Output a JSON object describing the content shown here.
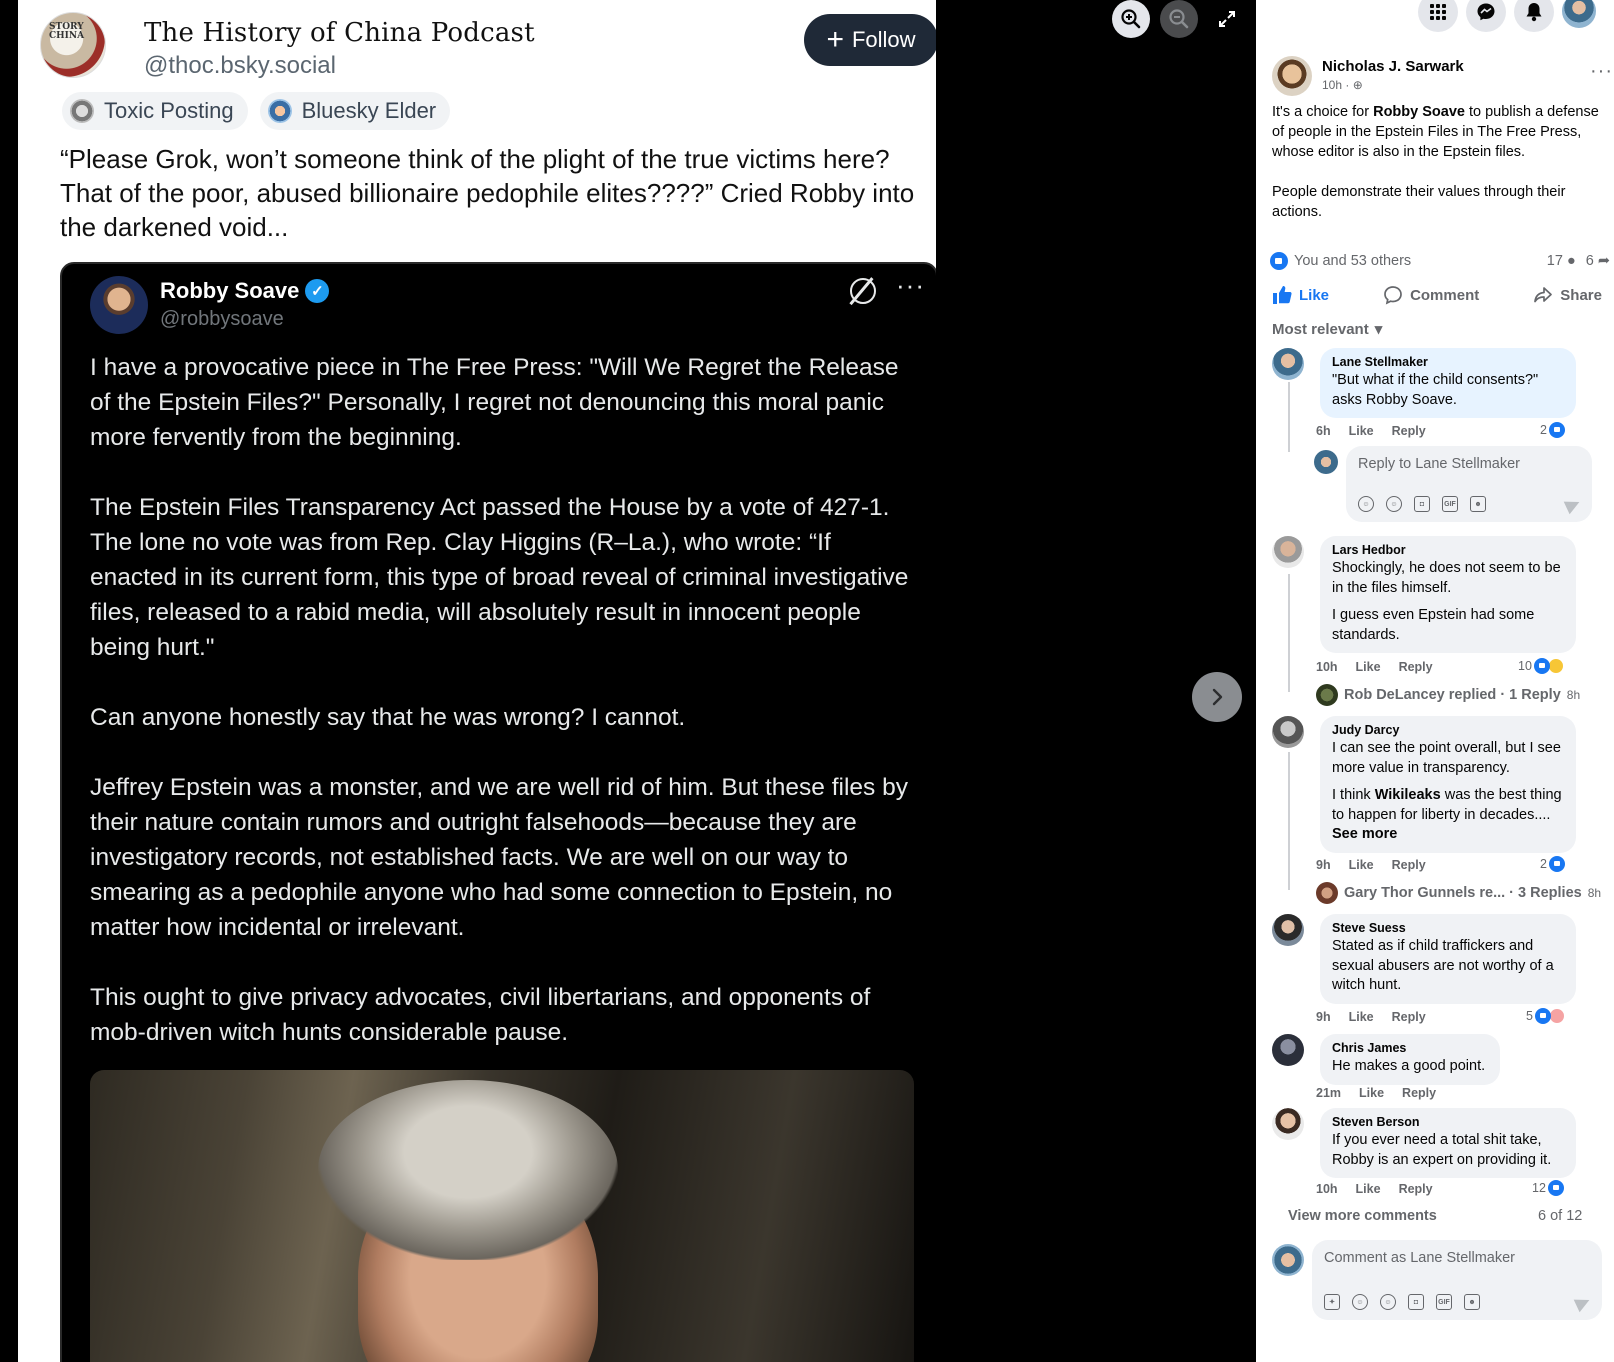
{
  "photo": {
    "bsky": {
      "name": "The History of China Podcast",
      "handle": "@thoc.bsky.social",
      "avatar_text": "STORY\nCHINA",
      "follow_label": "Follow",
      "badges": [
        "Toxic Posting",
        "Bluesky Elder"
      ],
      "text": "“Please Grok, won’t someone think of the plight of the true victims here? That of the poor, abused billionaire pedophile elites????” Cried Robby into the darkened void..."
    },
    "tweet": {
      "name": "Robby Soave",
      "handle": "@robbysoave",
      "paragraphs": [
        "I have a provocative piece in The Free Press: \"Will We Regret the Release of the Epstein Files?\" Personally, I regret not denouncing this moral panic more fervently from the beginning.",
        "The Epstein Files Transparency Act passed the House by a vote of 427-1. The lone no vote was from Rep. Clay Higgins (R–La.), who wrote: “If enacted in its current form, this type of broad reveal of criminal investigative files, released to a rabid media, will absolutely result in innocent people being hurt.\"",
        "Can anyone honestly say that he was wrong? I cannot.",
        "Jeffrey Epstein was a monster, and we are well rid of him. But these files by their nature contain rumors and outright falsehoods—because they are investigatory records, not established facts. We are well on our way to smearing as a pedophile anyone who had some connection to Epstein, no matter how incidental or irrelevant.",
        "This ought to give privacy advocates, civil libertarians, and opponents of mob-driven witch hunts considerable pause."
      ]
    }
  },
  "viewer": {
    "icons": [
      "zoom-in-icon",
      "zoom-out-icon",
      "fullscreen-icon",
      "next-arrow-icon"
    ]
  },
  "post": {
    "author": "Nicholas J. Sarwark",
    "time": "10h ·",
    "text_1_a": "It's a choice for ",
    "text_1_b": "Robby Soave",
    "text_1_c": " to publish a defense of people in the Epstein Files in The Free Press, whose editor is also in the Epstein files.",
    "text_2": "People demonstrate their values through their actions.",
    "reactions": "You and 53 others",
    "comment_count": "17",
    "share_count": "6",
    "actions": {
      "like": "Like",
      "comment": "Comment",
      "share": "Share"
    },
    "sort": "Most relevant"
  },
  "comments": [
    {
      "name": "Lane Stellmaker",
      "text": "\"But what if the child consents?\" asks Robby Soave.",
      "time": "6h",
      "like": "Like",
      "reply": "Reply",
      "count": "2"
    },
    {
      "name": "Lars Hedbor",
      "text_1": "Shockingly, he does not seem to be in the files himself.",
      "text_2": "I guess even Epstein had some standards.",
      "time": "10h",
      "like": "Like",
      "reply": "Reply",
      "count": "10",
      "replies": "Rob DeLancey replied · 1 Reply",
      "replies_time": "8h"
    },
    {
      "name": "Judy Darcy",
      "text_1": "I can see the point overall, but I see more value in transparency.",
      "text_2_a": "I think ",
      "text_2_b": "Wikileaks",
      "text_2_c": " was the best thing to happen for liberty in decades....",
      "see_more": "See more",
      "time": "9h",
      "like": "Like",
      "reply": "Reply",
      "count": "2",
      "replies": "Gary Thor Gunnels re...  · 3 Replies",
      "replies_time": "8h"
    },
    {
      "name": "Steve Suess",
      "text": "Stated as if child traffickers and sexual abusers are not worthy of a witch hunt.",
      "time": "9h",
      "like": "Like",
      "reply": "Reply",
      "count": "5"
    },
    {
      "name": "Chris James",
      "text": "He makes a good point.",
      "time": "21m",
      "like": "Like",
      "reply": "Reply"
    },
    {
      "name": "Steven Berson",
      "text": "If you ever need a total shit take, Robby is an expert on providing it.",
      "time": "10h",
      "like": "Like",
      "reply": "Reply",
      "count": "12"
    }
  ],
  "reply_placeholder": "Reply to Lane Stellmaker",
  "view_more": "View more comments",
  "of_count": "6 of 12",
  "comment_as_placeholder": "Comment as Lane Stellmaker",
  "colors": {
    "facebook_blue": "#1877f2",
    "comment_bubble": "#f0f2f5",
    "highlight_bubble": "#e7f3ff",
    "bsky_follow": "#1f2937"
  }
}
